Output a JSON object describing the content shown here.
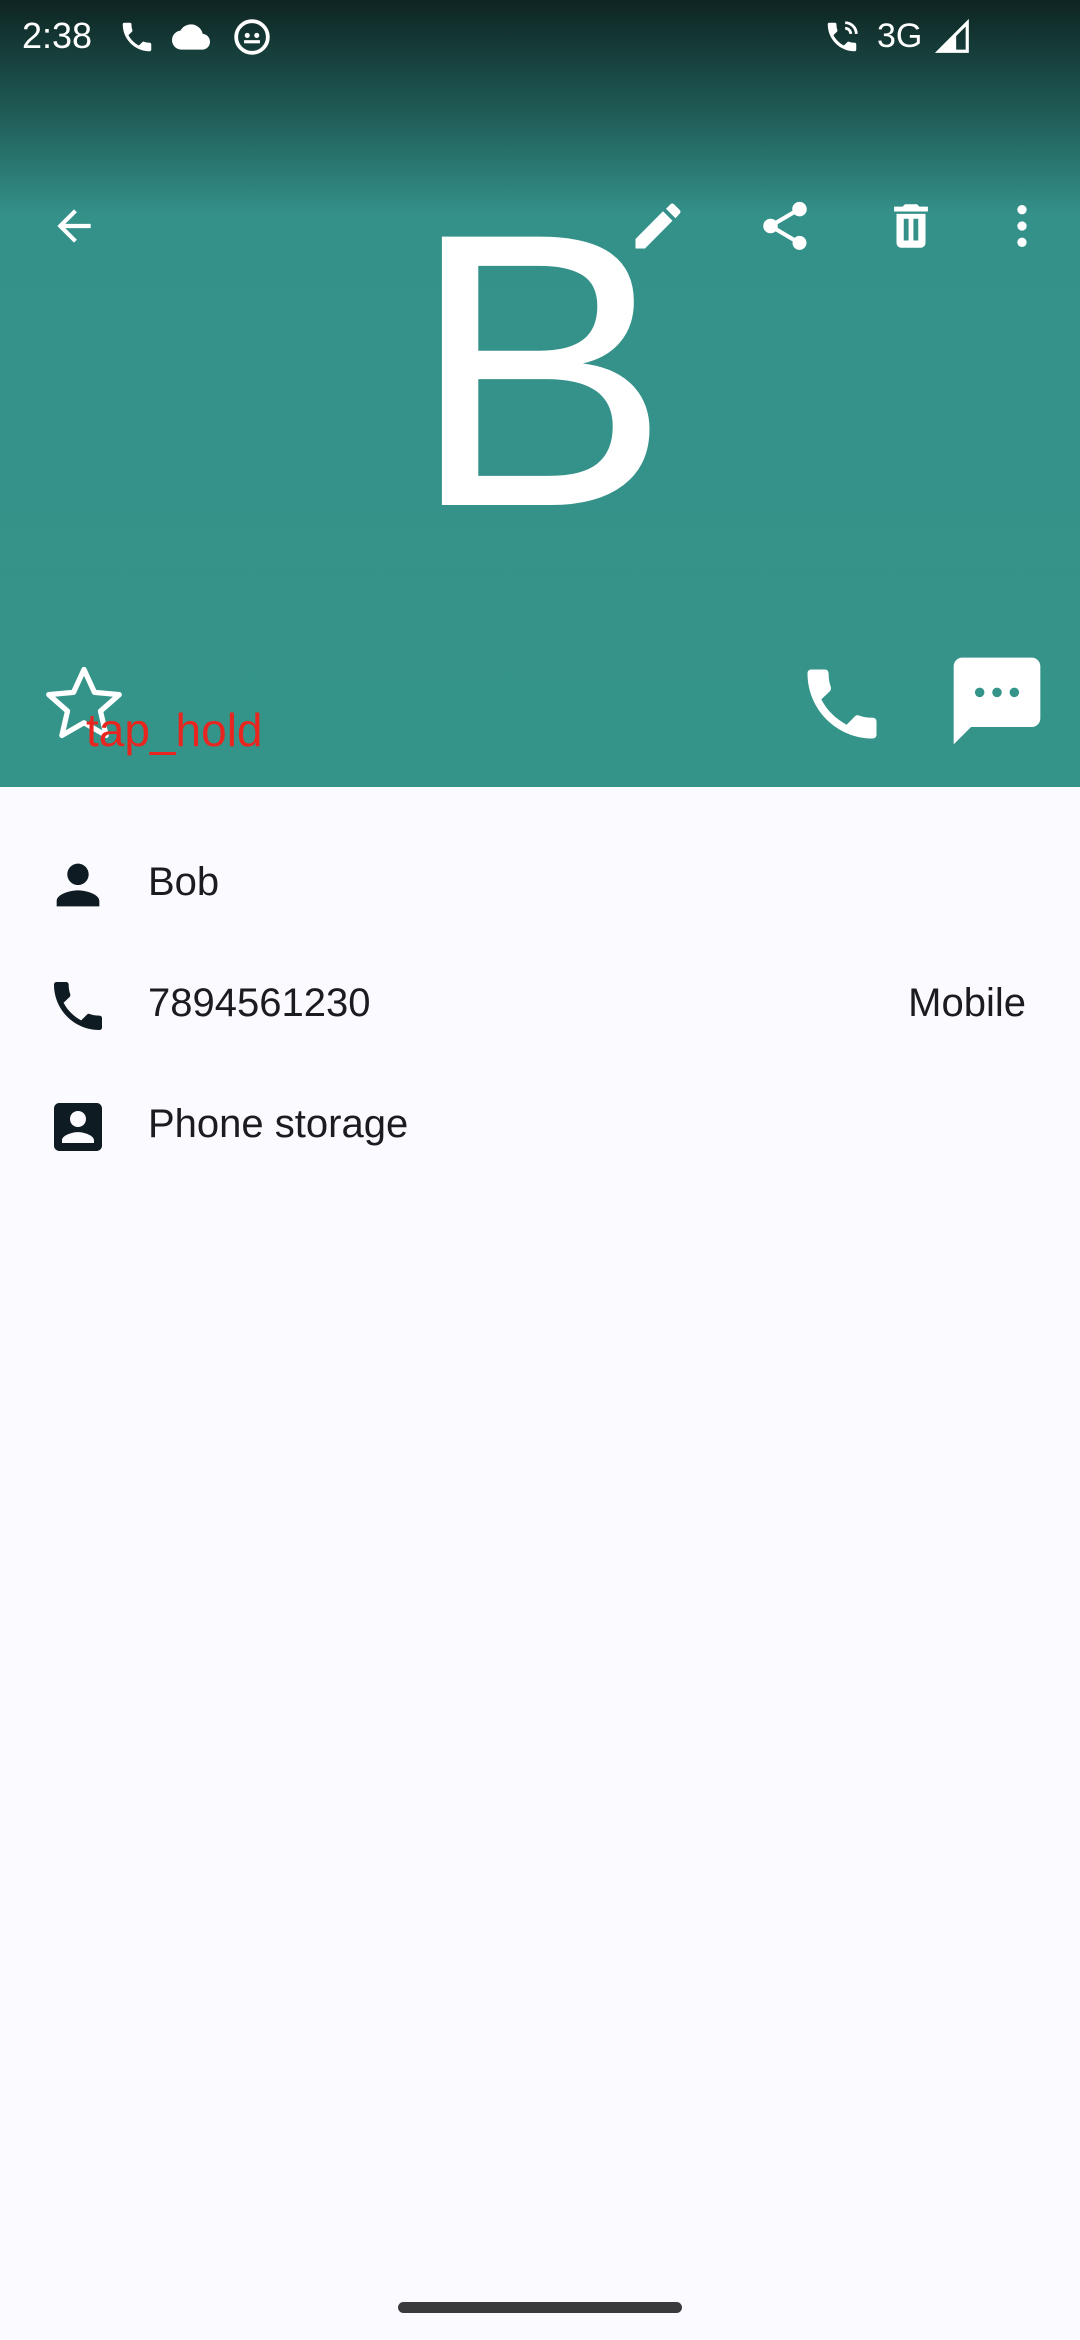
{
  "status_bar": {
    "time": "2:38",
    "network": "3G",
    "icons": [
      "phone-icon",
      "cloud-icon",
      "android-icon",
      "wifi-call-icon",
      "signal-icon"
    ]
  },
  "toolbar": {
    "back_icon": "arrow-back-icon",
    "edit_icon": "edit-icon",
    "share_icon": "share-icon",
    "delete_icon": "delete-icon",
    "more_icon": "more-vert-icon"
  },
  "contact": {
    "monogram": "B",
    "name": "Bob",
    "phone": "7894561230",
    "phone_type": "Mobile",
    "source": "Phone storage"
  },
  "actions": {
    "favorite_icon": "star-outline-icon",
    "call_icon": "phone-icon",
    "message_icon": "message-icon"
  },
  "overlay": {
    "label": "tap_hold"
  },
  "colors": {
    "header": "#359489",
    "header_top": "#0e2422",
    "background": "#fbfafe",
    "text": "#1b1c20",
    "overlay_text": "#e8261f"
  }
}
